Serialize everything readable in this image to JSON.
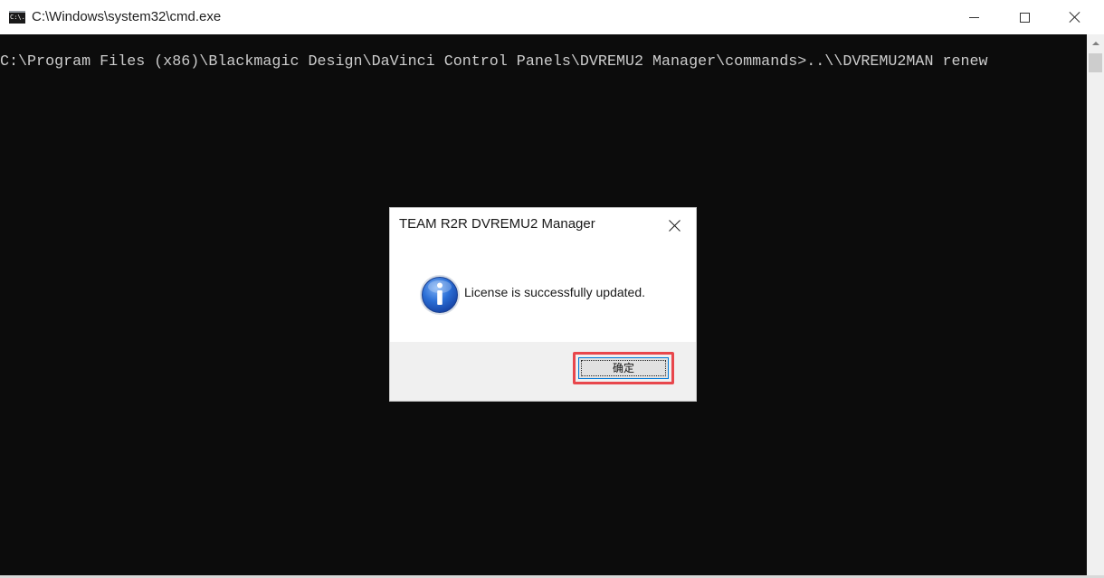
{
  "window": {
    "title": "C:\\Windows\\system32\\cmd.exe",
    "icon_label": "C:\\."
  },
  "console": {
    "line": "C:\\Program Files (x86)\\Blackmagic Design\\DaVinci Control Panels\\DVREMU2 Manager\\commands>..\\\\DVREMU2MAN renew"
  },
  "dialog": {
    "title": "TEAM R2R DVREMU2 Manager",
    "message": "License is successfully updated.",
    "ok_label": "确定"
  },
  "colors": {
    "console_bg": "#0c0c0c",
    "console_text": "#cccccc",
    "highlight": "#e8474c",
    "info_blue": "#2b6fd6"
  },
  "icons": {
    "app": "cmd-icon",
    "info": "info-icon",
    "close": "close-icon",
    "minimize": "minimize-icon",
    "maximize": "maximize-icon"
  }
}
